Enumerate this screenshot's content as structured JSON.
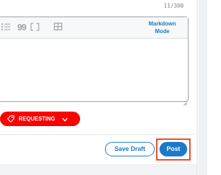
{
  "editor": {
    "char_count": "11/300",
    "markdown_toggle": "Markdown Mode",
    "toolbar_icons": [
      "bulleted-list-icon",
      "quote-icon",
      "code-block-icon",
      "table-icon"
    ],
    "quote_glyph": "99"
  },
  "flair": {
    "label": "REQUESTING",
    "color": "#ff0000"
  },
  "actions": {
    "save_draft_label": "Save Draft",
    "post_label": "Post",
    "accent_color": "#1a7ac7",
    "highlight_color": "#e9471e"
  }
}
